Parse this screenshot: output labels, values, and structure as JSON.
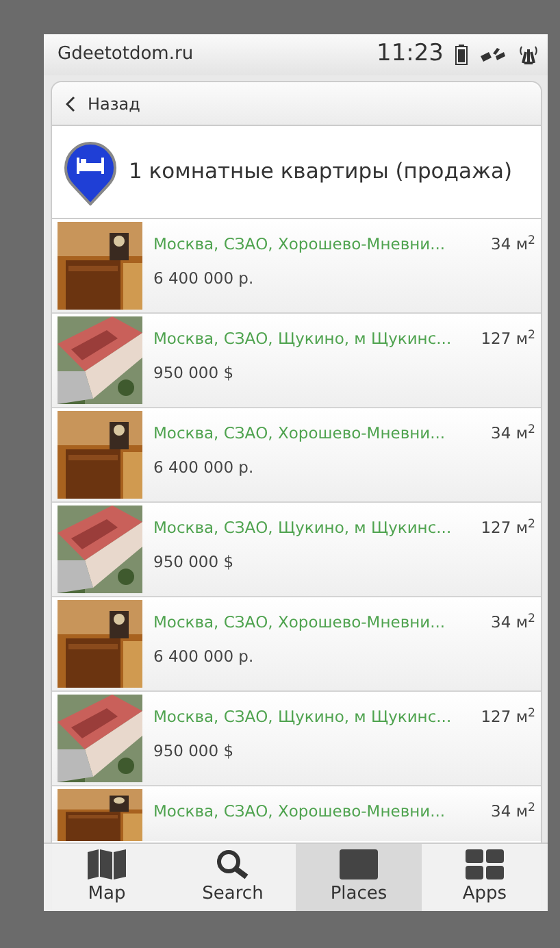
{
  "status_bar": {
    "site": "Gdeetotdom.ru",
    "time": "11:23"
  },
  "back_button": {
    "label": "Назад"
  },
  "header": {
    "title": "1 комнатные квартиры (продажа)"
  },
  "listings": [
    {
      "address": "Москва, СЗАО, Хорошево-Мневни...",
      "area": "34 м$^{2}$",
      "price": "6 400 000 р."
    },
    {
      "address": "Москва, СЗАО, Щукино, м Щукинс...",
      "area": "127 м$^{2}$",
      "price": "950 000 $"
    },
    {
      "address": "Москва, СЗАО, Хорошево-Мневни...",
      "area": "34 м$^{2}$",
      "price": "6 400 000 р."
    },
    {
      "address": "Москва, СЗАО, Щукино, м Щукинс...",
      "area": "127 м$^{2}$",
      "price": "950 000 $"
    },
    {
      "address": "Москва, СЗАО, Хорошево-Мневни...",
      "area": "34 м$^{2}$",
      "price": "6 400 000 р."
    },
    {
      "address": "Москва, СЗАО, Щукино, м Щукинс...",
      "area": "127 м$^{2}$",
      "price": "950 000 $"
    },
    {
      "address": "Москва, СЗАО, Хорошево-Мневни...",
      "area": "34 м$^{2}$"
    }
  ],
  "tab_bar": [
    {
      "kind": "map",
      "label": "Map",
      "selected": false
    },
    {
      "kind": "search",
      "label": "Search",
      "selected": false
    },
    {
      "kind": "places",
      "label": "Places",
      "selected": true
    },
    {
      "kind": "apps",
      "label": "Apps",
      "selected": false
    }
  ]
}
